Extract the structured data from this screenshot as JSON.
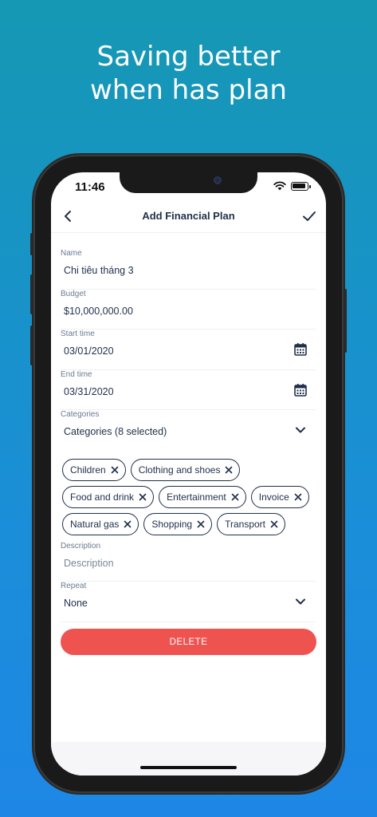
{
  "promo": {
    "line1": "Saving better",
    "line2": "when has plan"
  },
  "status_bar": {
    "time": "11:46",
    "icons": [
      "wifi-icon",
      "battery-icon"
    ]
  },
  "nav": {
    "title": "Add Financial Plan",
    "back_icon": "chevron-left-icon",
    "confirm_icon": "check-icon"
  },
  "form": {
    "name": {
      "label": "Name",
      "value": "Chi tiêu tháng 3"
    },
    "budget": {
      "label": "Budget",
      "value": "$10,000,000.00"
    },
    "start_time": {
      "label": "Start time",
      "value": "03/01/2020",
      "icon": "calendar-icon"
    },
    "end_time": {
      "label": "End time",
      "value": "03/31/2020",
      "icon": "calendar-icon"
    },
    "categories": {
      "label": "Categories",
      "value": "Categories (8 selected)",
      "selected": [
        "Children",
        "Clothing and shoes",
        "Food and drink",
        "Entertainment",
        "Invoice",
        "Natural gas",
        "Shopping",
        "Transport"
      ]
    },
    "description": {
      "label": "Description",
      "placeholder": "Description"
    },
    "repeat": {
      "label": "Repeat",
      "value": "None"
    }
  },
  "actions": {
    "delete_label": "DELETE"
  },
  "colors": {
    "accent": "#1f2f4a",
    "danger": "#ef5350",
    "background_top": "#1598b3",
    "background_bottom": "#1e87e6"
  }
}
